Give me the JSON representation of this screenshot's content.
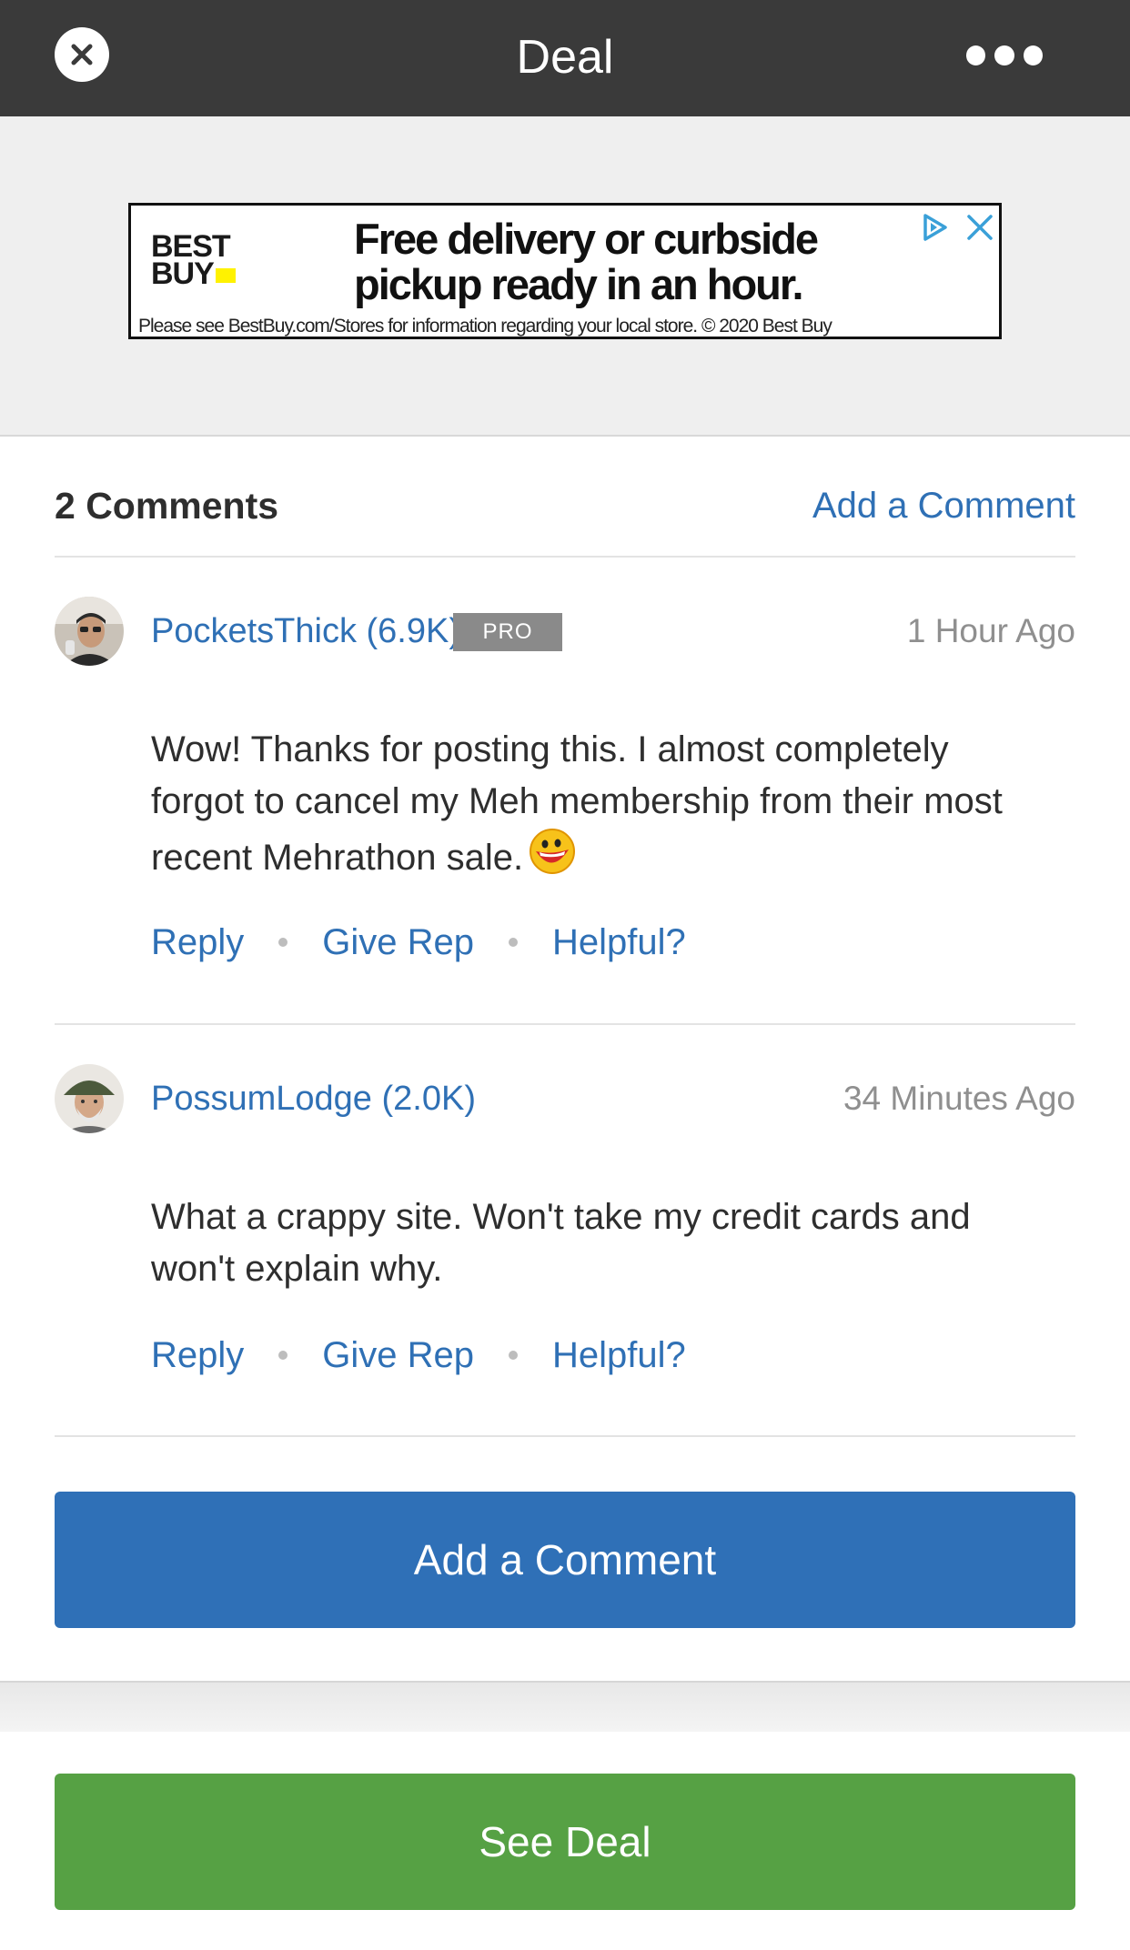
{
  "header": {
    "title": "Deal"
  },
  "ad": {
    "brand_line1": "BEST",
    "brand_line2": "BUY",
    "headline_line1": "Free delivery or curbside",
    "headline_line2": "pickup ready in an hour.",
    "fine_print": "Please see BestBuy.com/Stores for information regarding your local store. © 2020 Best Buy",
    "brand_color": "#fff200"
  },
  "comments_section": {
    "count_label": "2 Comments",
    "add_link_label": "Add a Comment"
  },
  "comments": [
    {
      "author": "PocketsThick (6.9K)",
      "badge": "PRO",
      "time": "1 Hour Ago",
      "body_lines": [
        "Wow! Thanks for posting this. I almost completely",
        "forgot to cancel my Meh membership from their most",
        "recent Mehrathon sale."
      ],
      "actions": [
        "Reply",
        "Give Rep",
        "Helpful?"
      ]
    },
    {
      "author": "PossumLodge (2.0K)",
      "time": "34 Minutes Ago",
      "body_lines": [
        "What a crappy site. Won't take my credit cards and",
        "won't explain why."
      ],
      "actions": [
        "Reply",
        "Give Rep",
        "Helpful?"
      ]
    }
  ],
  "buttons": {
    "add_comment": "Add a Comment",
    "see_deal": "See Deal"
  },
  "colors": {
    "topbar": "#3a3a3a",
    "link": "#2f70b5",
    "primary_button": "#2f70b7",
    "deal_button": "#56a144"
  },
  "icons": {
    "close": "close-icon",
    "more": "more-dots-icon",
    "ad_choices": "ad-choices-icon",
    "ad_close": "ad-close-icon",
    "emoji": "laughing-emoji-icon"
  }
}
